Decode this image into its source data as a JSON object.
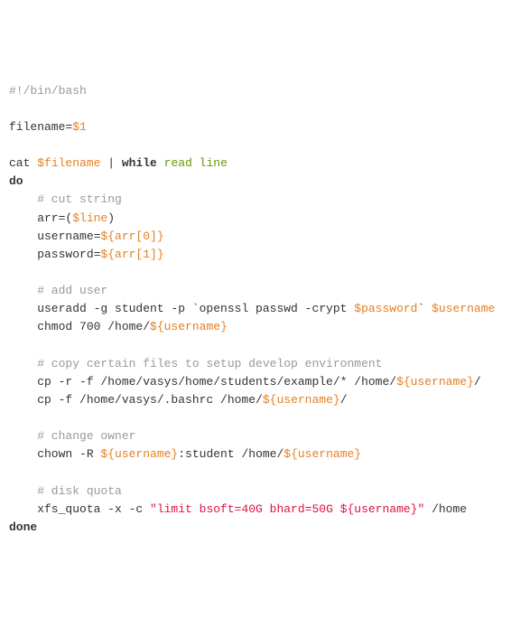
{
  "code": {
    "l01_shebang": "#!/bin/bash",
    "l02_fn_lhs": "filename=",
    "l02_fn_rhs": "$1",
    "l03_cat": "cat ",
    "l03_fname": "$filename",
    "l03_pipe": " | ",
    "l03_while": "while",
    "l03_read": " read line",
    "l04_do": "do",
    "l05_cmt_cut": "    # cut string",
    "l06_arr_lhs": "    arr=(",
    "l06_arr_var": "$line",
    "l06_arr_rhs": ")",
    "l07_user_lhs": "    username=",
    "l07_user_rhs": "${arr[0]}",
    "l08_pass_lhs": "    password=",
    "l08_pass_rhs": "${arr[1]}",
    "l09_cmt_add": "    # add user",
    "l10_ua_a": "    useradd -g student -p `openssl passwd -crypt ",
    "l10_ua_pw": "$password",
    "l10_ua_b": "` ",
    "l10_ua_un": "$username",
    "l11_chmod_a": "    chmod 700 /home/",
    "l11_chmod_un": "${username}",
    "l12_cmt_copy": "    # copy certain files to setup develop environment",
    "l13_cp1_a": "    cp -r -f /home/vasys/home/students/example/* /home/",
    "l13_cp1_un": "${username}",
    "l13_cp1_b": "/",
    "l14_cp2_a": "    cp -f /home/vasys/.bashrc /home/",
    "l14_cp2_un": "${username}",
    "l14_cp2_b": "/",
    "l15_cmt_own": "    # change owner",
    "l16_chown_a": "    chown -R ",
    "l16_chown_un1": "${username}",
    "l16_chown_b": ":student /home/",
    "l16_chown_un2": "${username}",
    "l17_cmt_quota": "    # disk quota",
    "l18_xfs_a": "    xfs_quota -x -c ",
    "l18_xfs_str": "\"limit bsoft=40G bhard=50G ${username}\"",
    "l18_xfs_b": " /home",
    "l19_done": "done"
  }
}
